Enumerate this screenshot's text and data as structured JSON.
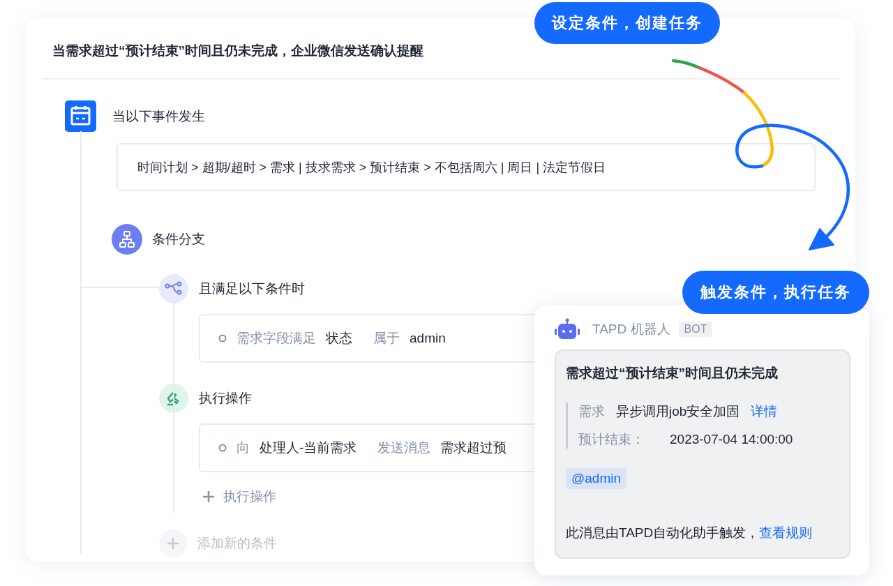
{
  "callouts": [
    {
      "text": "设定条件，创建任务",
      "kind": "top"
    },
    {
      "text": "触发条件，执行任务",
      "kind": "bottom"
    }
  ],
  "rule": {
    "title": "当需求超过“预计结束”时间且仍未完成，企业微信发送确认提醒",
    "trigger": {
      "label": "当以下事件发生",
      "path": "时间计划 > 超期/超时 > 需求 | 技求需求 > 预计结束 > 不包括周六 | 周日 | 法定节假日"
    },
    "branch": {
      "label": "条件分支",
      "condition": {
        "label": "且满足以下条件时",
        "parts": [
          {
            "text": "需求字段满足",
            "kind": "muted"
          },
          {
            "text": "状态",
            "kind": "strong"
          },
          {
            "text": "属于",
            "kind": "muted"
          },
          {
            "text": "admin",
            "kind": "strong"
          }
        ]
      },
      "action": {
        "label": "执行操作",
        "parts": [
          {
            "text": "向",
            "kind": "muted"
          },
          {
            "text": "处理人-当前需求",
            "kind": "strong"
          },
          {
            "text": "发送消息",
            "kind": "muted"
          },
          {
            "text": "需求超过预",
            "kind": "strong"
          }
        ]
      },
      "add_action": {
        "label": "执行操作"
      }
    },
    "add_condition": {
      "label": "添加新的条件"
    }
  },
  "message": {
    "sender": "TAPD 机器人",
    "tag": "BOT",
    "title": "需求超过“预计结束”时间且仍未完成",
    "fields": [
      {
        "label": "需求",
        "value": "异步调用job安全加固",
        "link": "详情"
      },
      {
        "label": "预计结束：",
        "value": "2023-07-04 14:00:00"
      }
    ],
    "mention": "@admin",
    "footer": "此消息由TAPD自动化助手触发，",
    "footer_link": "查看规则"
  }
}
